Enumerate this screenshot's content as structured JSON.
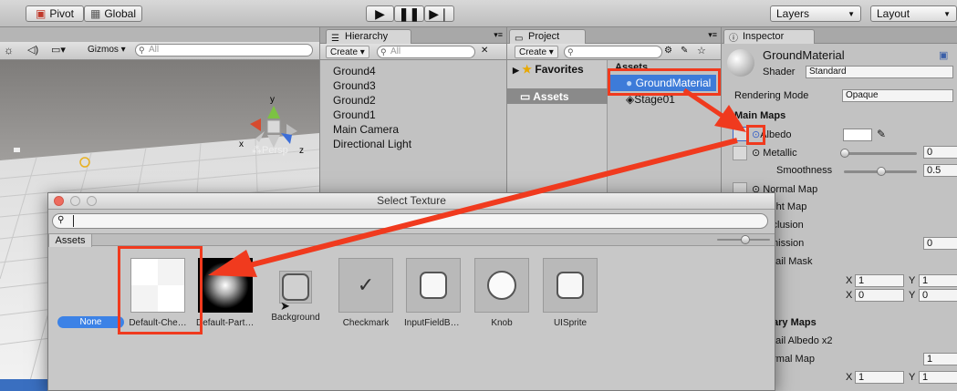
{
  "toolbar": {
    "pivot": "Pivot",
    "global": "Global",
    "layers": "Layers",
    "layout": "Layout"
  },
  "scene": {
    "gizmos": "Gizmos",
    "search_placeholder": "All",
    "persp": "Persp",
    "axis_x": "x",
    "axis_y": "y",
    "axis_z": "z"
  },
  "hierarchy": {
    "title": "Hierarchy",
    "create": "Create",
    "search_placeholder": "All",
    "items": [
      "Ground4",
      "Ground3",
      "Ground2",
      "Ground1",
      "Main Camera",
      "Directional Light"
    ]
  },
  "project": {
    "title": "Project",
    "create": "Create",
    "favorites": "Favorites",
    "assets": "Assets",
    "assets_header": "Assets",
    "files": [
      "GroundMaterial",
      "Stage01"
    ]
  },
  "inspector": {
    "title": "Inspector",
    "material_name": "GroundMaterial",
    "shader_label": "Shader",
    "shader_value": "Standard",
    "rendering_mode_label": "Rendering Mode",
    "rendering_mode_value": "Opaque",
    "main_maps": "Main Maps",
    "albedo": "Albedo",
    "metallic": "Metallic",
    "metallic_value": "0",
    "smoothness": "Smoothness",
    "smoothness_value": "0.5",
    "normal_map": "Normal Map",
    "height_map": "eight Map",
    "occlusion": "cclusion",
    "emission": "mission",
    "emission_value": "0",
    "detail_mask": "etail Mask",
    "tiling_x_label": "X",
    "tiling_x": "1",
    "tiling_y_label": "Y",
    "tiling_y": "1",
    "offset_x_label": "X",
    "offset_x": "0",
    "offset_y_label": "Y",
    "offset_y": "0",
    "secondary_maps": "ary Maps",
    "detail_albedo": "etail Albedo x2",
    "sec_normal_map": "ormal Map",
    "sec_normal_value": "1",
    "sec_x_label": "X",
    "sec_x": "1",
    "sec_y_label": "Y",
    "sec_y": "1"
  },
  "dialog": {
    "title": "Select Texture",
    "tab": "Assets",
    "none": "None",
    "items": [
      "Default-Che…",
      "Default-Parti…",
      "Background",
      "Checkmark",
      "InputFieldBa…",
      "Knob",
      "UISprite"
    ]
  },
  "colors": {
    "accent": "#f03a1e",
    "selection": "#3d7bd9",
    "none_button": "#3c82e6"
  }
}
